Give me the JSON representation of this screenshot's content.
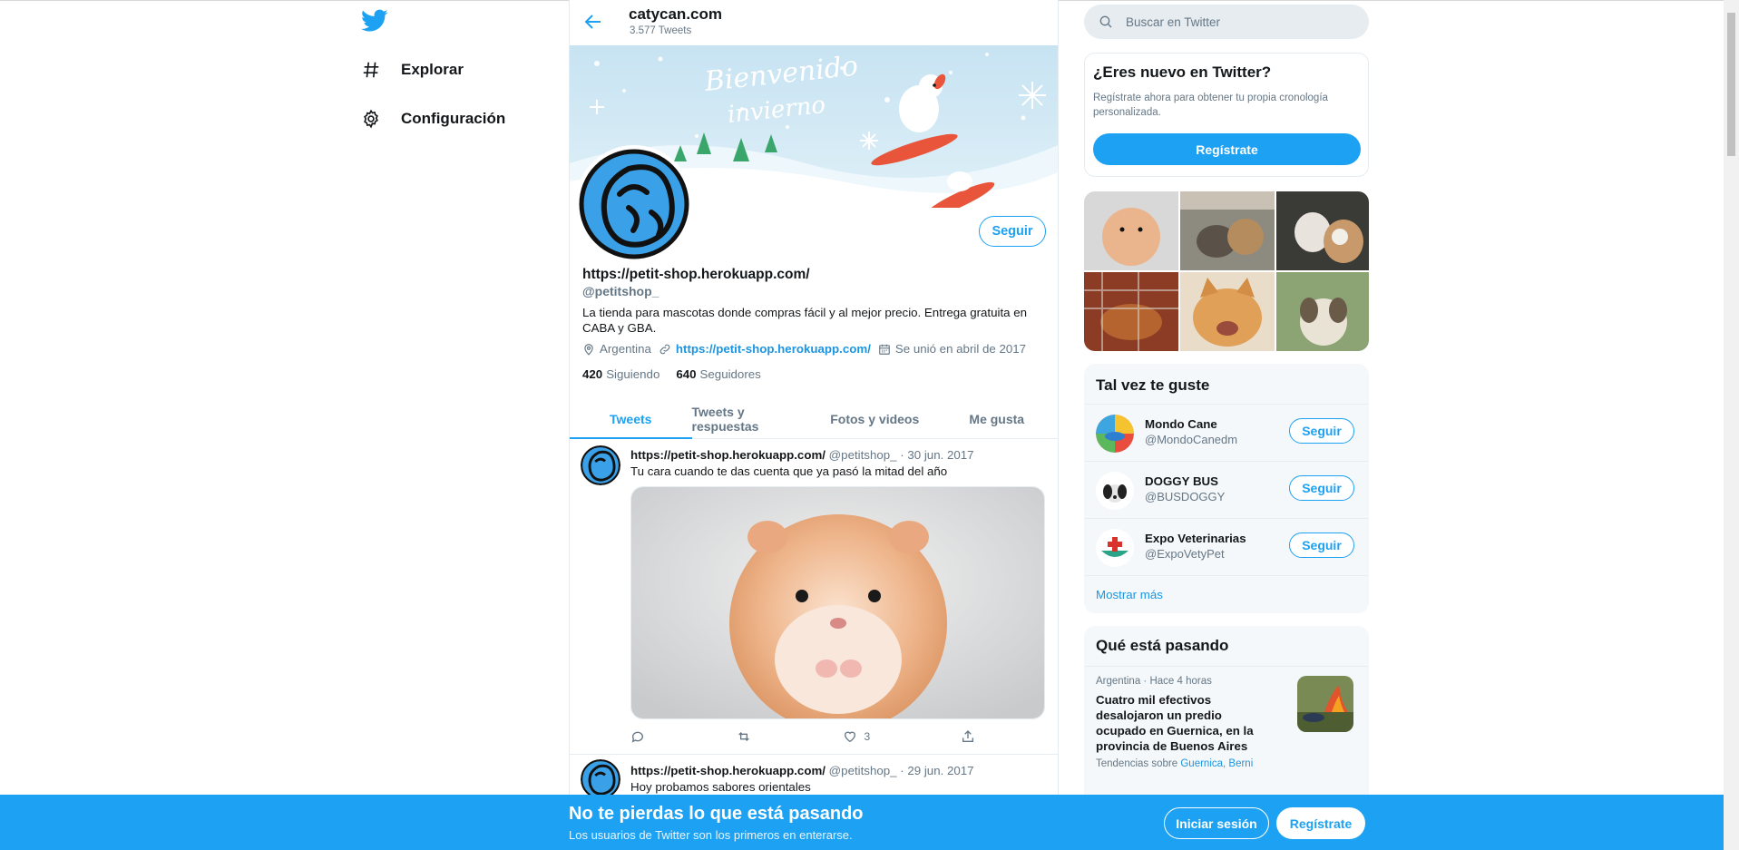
{
  "nav": {
    "items": [
      {
        "label": "Explorar",
        "icon": "hashtag-icon"
      },
      {
        "label": "Configuración",
        "icon": "gear-icon"
      }
    ]
  },
  "header": {
    "title": "catycan.com",
    "tweet_count": "3.577 Tweets"
  },
  "banner": {
    "text_line1": "Bienvenido",
    "text_line2": "invierno"
  },
  "profile": {
    "follow_label": "Seguir",
    "name": "https://petit-shop.herokuapp.com/",
    "handle": "@petitshop_",
    "bio": "La tienda para mascotas donde compras fácil y al mejor precio. Entrega gratuita en CABA y GBA.",
    "location": "Argentina",
    "website": "https://petit-shop.herokuapp.com/",
    "joined": "Se unió en abril de 2017",
    "following_count": "420",
    "following_label": "Siguiendo",
    "followers_count": "640",
    "followers_label": "Seguidores"
  },
  "tabs": [
    {
      "label": "Tweets",
      "active": true
    },
    {
      "label": "Tweets y respuestas",
      "active": false
    },
    {
      "label": "Fotos y videos",
      "active": false
    },
    {
      "label": "Me gusta",
      "active": false
    }
  ],
  "tweets": [
    {
      "name": "https://petit-shop.herokuapp.com/",
      "handle": "@petitshop_",
      "date": "· 30 jun. 2017",
      "text": "Tu cara cuando te das cuenta que ya pasó la mitad del año",
      "likes": "3"
    },
    {
      "name": "https://petit-shop.herokuapp.com/",
      "handle": "@petitshop_",
      "date": "· 29 jun. 2017",
      "text": "Hoy probamos sabores orientales"
    }
  ],
  "search": {
    "placeholder": "Buscar en Twitter"
  },
  "signup_card": {
    "title": "¿Eres nuevo en Twitter?",
    "desc": "Regístrate ahora para obtener tu propia cronología personalizada.",
    "button": "Regístrate"
  },
  "who_to_follow": {
    "title": "Tal vez te guste",
    "items": [
      {
        "name": "Mondo Cane",
        "handle": "@MondoCanedm",
        "button": "Seguir"
      },
      {
        "name": "DOGGY BUS",
        "handle": "@BUSDOGGY",
        "button": "Seguir"
      },
      {
        "name": "Expo Veterinarias",
        "handle": "@ExpoVetyPet",
        "button": "Seguir"
      }
    ],
    "more": "Mostrar más"
  },
  "trends": {
    "title": "Qué está pasando",
    "item": {
      "meta": "Argentina · Hace 4 horas",
      "headline": "Cuatro mil efectivos desalojaron un predio ocupado en Guernica, en la provincia de Buenos Aires",
      "tags_prefix": "Tendencias sobre",
      "tags": "Guernica, Berni"
    }
  },
  "bottom_bar": {
    "title": "No te pierdas lo que está pasando",
    "subtitle": "Los usuarios de Twitter son los primeros en enterarse.",
    "login": "Iniciar sesión",
    "signup": "Regístrate"
  },
  "colors": {
    "accent": "#1da1f2",
    "link": "#1b95e0",
    "secondary_text": "#657786",
    "border": "#e6ecf0"
  }
}
